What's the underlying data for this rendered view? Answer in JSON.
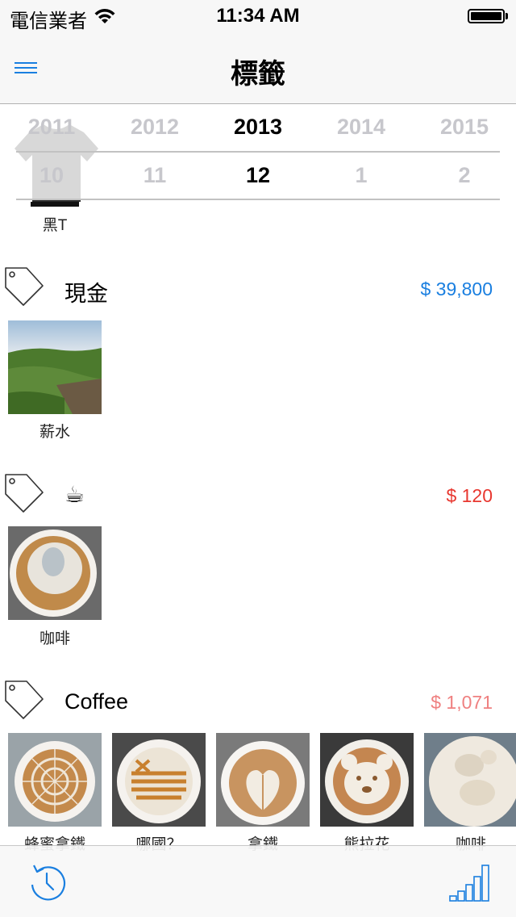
{
  "status_bar": {
    "carrier": "電信業者",
    "time": "11:34 AM"
  },
  "nav": {
    "title": "標籤",
    "menu_icon": "hamburger-menu-icon"
  },
  "picker": {
    "years": [
      "2011",
      "2012",
      "2013",
      "2014",
      "2015"
    ],
    "months": [
      "10",
      "11",
      "12",
      "1",
      "2"
    ],
    "selected_year": "2013",
    "selected_month": "12"
  },
  "partial_item": {
    "label": "黑T"
  },
  "sections": [
    {
      "name": "現金",
      "amount": "$ 39,800",
      "amount_color": "#1a7fe0",
      "items": [
        {
          "label": "薪水",
          "image": "landscape-photo"
        }
      ]
    },
    {
      "name": "☕",
      "amount": "$ 120",
      "amount_color": "#e8372f",
      "items": [
        {
          "label": "咖啡",
          "image": "latte-art-photo"
        }
      ]
    },
    {
      "name": "Coffee",
      "amount": "$ 1,071",
      "amount_color": "#ef8080",
      "items": [
        {
          "label": "蜂蜜拿鐵",
          "image": "latte-photo"
        },
        {
          "label": "哪國？",
          "image": "flag-latte-photo"
        },
        {
          "label": "拿鐵",
          "image": "heart-latte-photo"
        },
        {
          "label": "熊拉花",
          "image": "bear-latte-photo"
        },
        {
          "label": "咖啡",
          "image": "foam-latte-photo"
        }
      ]
    }
  ],
  "toolbar": {
    "left_icon": "history-clock-icon",
    "right_icon": "bar-chart-icon"
  }
}
